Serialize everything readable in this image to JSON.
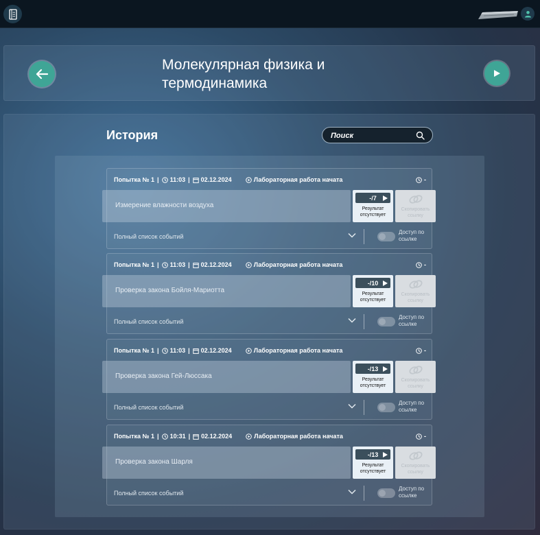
{
  "header": {
    "title": "Молекулярная физика и термодинамика"
  },
  "history": {
    "title": "История",
    "search_placeholder": "Поиск"
  },
  "attempts": [
    {
      "attempt": "Попытка № 1",
      "time": "11:03",
      "date": "02.12.2024",
      "status": "Лабораторная работа начата",
      "duration": "-",
      "name": "Измерение влажности воздуха",
      "score": "-/7",
      "result_text": "Результат отсутствует",
      "copy_text": "Скопировать ссылку",
      "events_label": "Полный список событий",
      "access_text": "Доступ по ссылке"
    },
    {
      "attempt": "Попытка № 1",
      "time": "11:03",
      "date": "02.12.2024",
      "status": "Лабораторная работа начата",
      "duration": "-",
      "name": "Проверка закона Бойля-Мариотта",
      "score": "-/10",
      "result_text": "Результат отсутствует",
      "copy_text": "Скопировать ссылку",
      "events_label": "Полный список событий",
      "access_text": "Доступ по ссылке"
    },
    {
      "attempt": "Попытка № 1",
      "time": "11:03",
      "date": "02.12.2024",
      "status": "Лабораторная работа начата",
      "duration": "-",
      "name": "Проверка закона Гей-Люссака",
      "score": "-/13",
      "result_text": "Результат отсутствует",
      "copy_text": "Скопировать ссылку",
      "events_label": "Полный список событий",
      "access_text": "Доступ по ссылке"
    },
    {
      "attempt": "Попытка № 1",
      "time": "10:31",
      "date": "02.12.2024",
      "status": "Лабораторная работа начата",
      "duration": "-",
      "name": "Проверка закона Шарля",
      "score": "-/13",
      "result_text": "Результат отсутствует",
      "copy_text": "Скопировать ссылку",
      "events_label": "Полный список событий",
      "access_text": "Доступ по ссылке"
    }
  ],
  "icons": {
    "logo": "notebook-icon",
    "device": "device-icon",
    "user": "user-icon",
    "back": "arrow-left-icon",
    "play": "play-icon",
    "search": "search-icon"
  },
  "colors": {
    "accent": "#3fa596",
    "topbar": "#0b1620"
  }
}
